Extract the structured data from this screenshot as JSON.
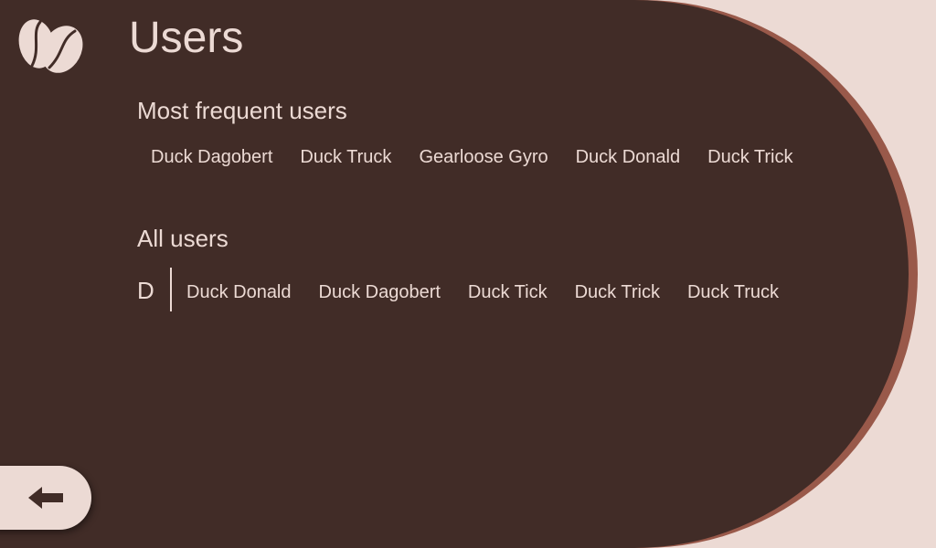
{
  "header": {
    "title": "Users",
    "logo_icon": "coffee-beans-icon"
  },
  "frequent": {
    "title": "Most frequent users",
    "users": [
      "Duck Dagobert",
      "Duck Truck",
      "Gearloose Gyro",
      "Duck Donald",
      "Duck Trick"
    ]
  },
  "all": {
    "title": "All users",
    "letter": "D",
    "users": [
      "Duck Donald",
      "Duck Dagobert",
      "Duck Tick",
      "Duck Trick",
      "Duck Truck"
    ]
  },
  "footer": {
    "back_icon": "arrow-left-icon"
  },
  "colors": {
    "background": "#ecdad4",
    "panel": "#412c27",
    "panel_accent": "#99594a",
    "text": "#ecdad4"
  }
}
